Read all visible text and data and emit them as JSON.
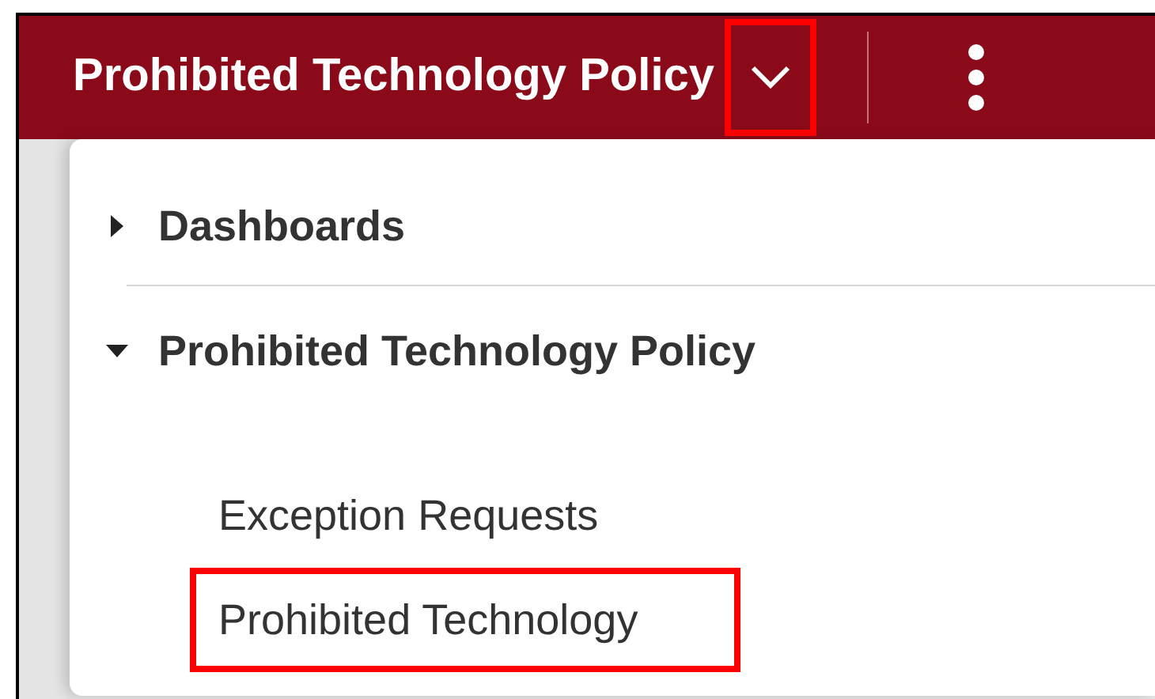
{
  "header": {
    "title": "Prohibited Technology Policy",
    "dropdown_highlighted": true
  },
  "menu": [
    {
      "label": "Dashboards",
      "expanded": false
    },
    {
      "label": "Prohibited Technology Policy",
      "expanded": true,
      "children": [
        {
          "label": "Exception Requests",
          "highlighted": false
        },
        {
          "label": "Prohibited Technology",
          "highlighted": true
        }
      ]
    }
  ]
}
